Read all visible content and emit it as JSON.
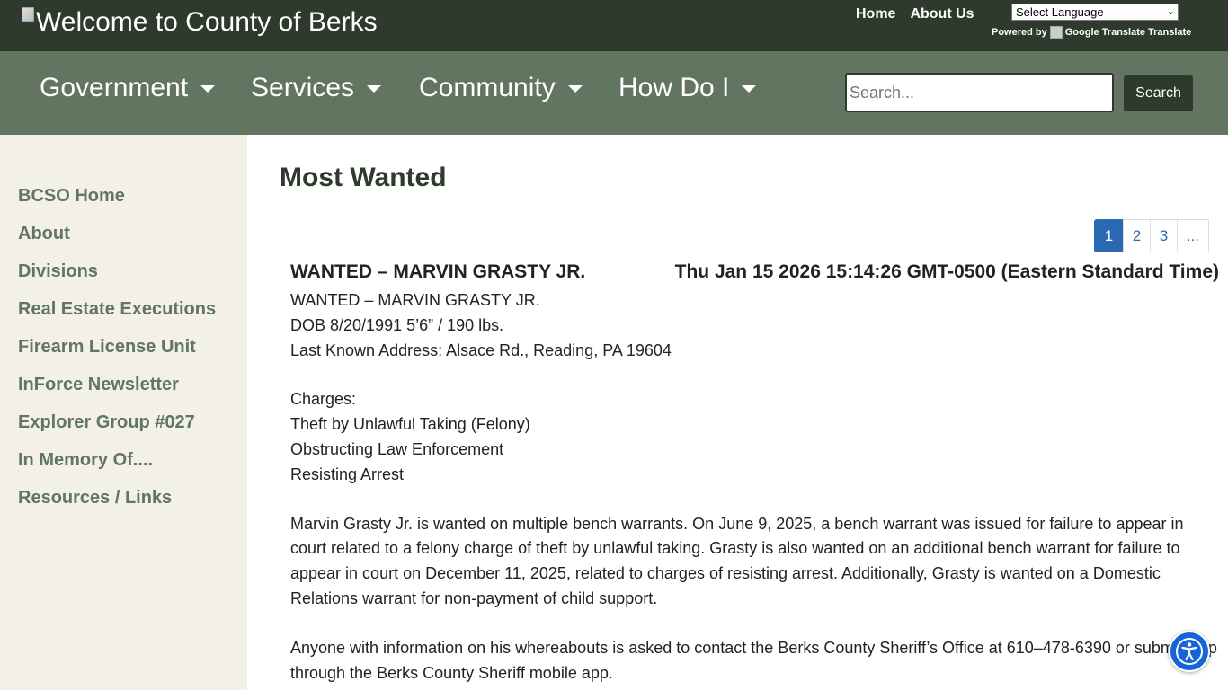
{
  "header": {
    "logo_alt": "Welcome to County of Berks",
    "links": [
      "Home",
      "About Us"
    ],
    "language_select": "Select Language",
    "powered_by": "Powered by",
    "google_translate_alt": "Google Translate",
    "translate": "Translate"
  },
  "nav": {
    "items": [
      "Government",
      "Services",
      "Community",
      "How Do I"
    ],
    "search_placeholder": "Search...",
    "search_button": "Search"
  },
  "sidebar": {
    "items": [
      "BCSO Home",
      "About",
      "Divisions",
      "Real Estate Executions",
      "Firearm License Unit",
      "InForce Newsletter",
      "Explorer Group #027",
      "In Memory Of....",
      "Resources / Links"
    ]
  },
  "main": {
    "title": "Most Wanted",
    "pagination": [
      "1",
      "2",
      "3",
      "..."
    ],
    "post": {
      "title": "WANTED – MARVIN GRASTY JR.",
      "date": "Thu Jan 15 2026 15:14:26 GMT-0500 (Eastern Standard Time)",
      "lines": [
        "WANTED – MARVIN GRASTY JR.",
        "DOB 8/20/1991 5’6” / 190 lbs.",
        "Last Known Address: Alsace Rd., Reading, PA 19604"
      ],
      "charges_label": "Charges:",
      "charges": [
        "Theft by Unlawful Taking (Felony)",
        "Obstructing Law Enforcement",
        "Resisting Arrest"
      ],
      "paragraph1": "Marvin Grasty Jr. is wanted on multiple bench warrants. On June 9, 2025, a bench warrant was issued for failure to appear in court related to a felony charge of theft by unlawful taking. Grasty is also wanted on an additional bench warrant for failure to appear in court on December 11, 2025, related to charges of resisting arrest. Additionally, Grasty is wanted on a Domestic Relations warrant for non-payment of child support.",
      "paragraph2": "Anyone with information on his whereabouts is asked to contact the Berks County Sheriff’s Office at 610–478-6390 or submit a tip through the Berks County Sheriff mobile app."
    }
  },
  "accessibility": {
    "icon": "accessibility-person-icon"
  },
  "colors": {
    "topbar": "#2e3a2c",
    "navbar": "#617560",
    "sidebar_bg": "#f3f1e6",
    "link_green": "#617560",
    "pager_blue": "#2a6ab5",
    "access_blue": "#1565d8"
  }
}
